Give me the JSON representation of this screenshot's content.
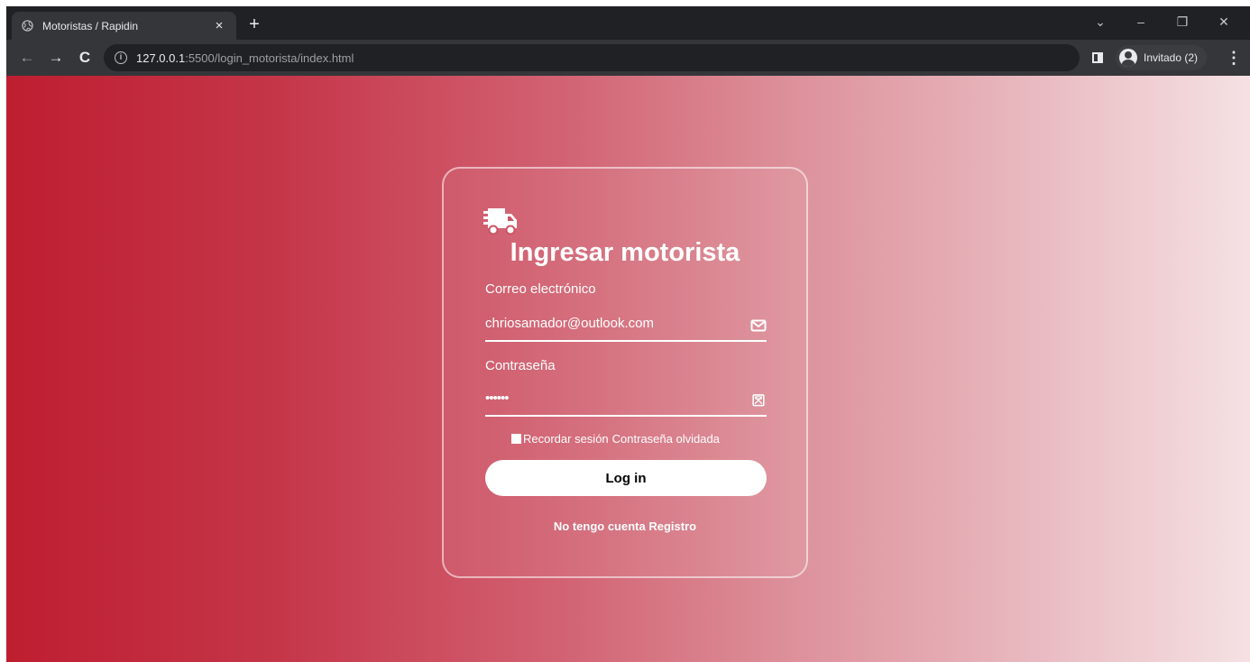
{
  "browser": {
    "tab_title": "Motoristas / Rapidin",
    "tab_close": "×",
    "new_tab": "+",
    "url_host": "127.0.0.1",
    "url_rest": ":5500/login_motorista/index.html",
    "profile_label": "Invitado (2)",
    "window_controls": {
      "tab_search": "⌄",
      "minimize": "–",
      "restore": "❐",
      "close": "✕"
    },
    "nav": {
      "back": "←",
      "forward": "→",
      "reload": "C",
      "info": "i",
      "menu": "⋮"
    }
  },
  "login": {
    "title": "Ingresar motorista",
    "email_label": "Correo electrónico",
    "email_value": "chriosamador@outlook.com",
    "password_label": "Contraseña",
    "password_value": "••••••",
    "remember_label": "Recordar sesión",
    "forgot_label": "Contraseña olvidada",
    "login_button": "Log in",
    "no_account": "No tengo cuenta",
    "register_link": "Registro"
  },
  "colors": {
    "gradient_start": "#be1e30",
    "gradient_end": "#f5e1e3",
    "chrome_dark": "#202124",
    "chrome_toolbar": "#35363a"
  }
}
